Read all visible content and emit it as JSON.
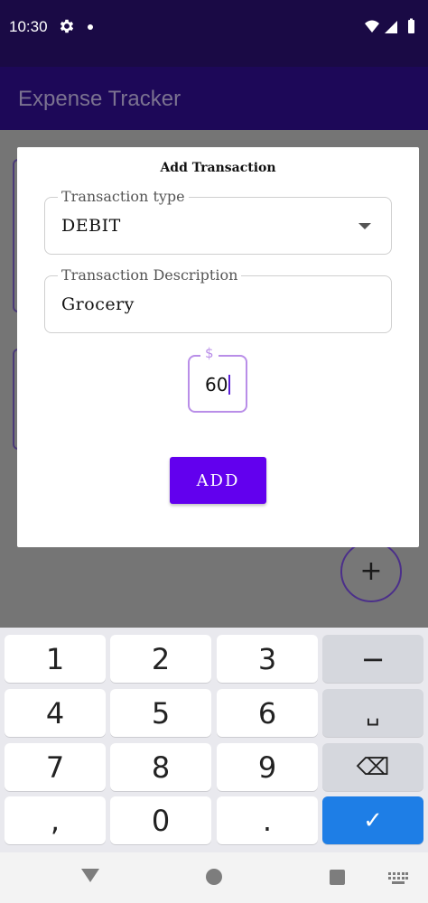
{
  "status_bar": {
    "time": "10:30",
    "icons": [
      "gear-icon",
      "dot-icon",
      "wifi-icon",
      "signal-icon",
      "battery-icon"
    ]
  },
  "app_bar": {
    "title": "Expense Tracker"
  },
  "dialog": {
    "title": "Add Transaction",
    "transaction_type": {
      "label": "Transaction type",
      "value": "DEBIT"
    },
    "description": {
      "label": "Transaction Description",
      "value": "Grocery"
    },
    "amount": {
      "prefix": "$",
      "value": "60"
    },
    "add_button": "ADD"
  },
  "fab": {
    "label": "+"
  },
  "keyboard": {
    "rows": [
      [
        "1",
        "2",
        "3",
        "−"
      ],
      [
        "4",
        "5",
        "6",
        "␣"
      ],
      [
        "7",
        "8",
        "9",
        "⌫"
      ],
      [
        ",",
        "0",
        ".",
        "✓"
      ]
    ]
  },
  "colors": {
    "primary": "#6200ee",
    "status_bar": "#1a0a45",
    "app_bar": "#1d0858",
    "done_key": "#1e7ee6"
  }
}
